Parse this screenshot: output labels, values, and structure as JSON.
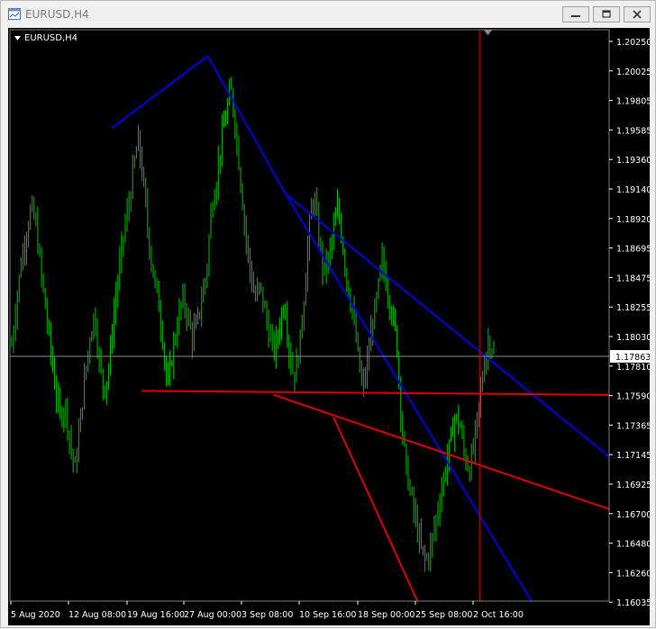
{
  "window": {
    "title": "EURUSD,H4",
    "minimize_icon": "minimize-icon",
    "restore_icon": "restore-icon",
    "close_icon": "close-icon"
  },
  "chart": {
    "symbol_label": "EURUSD,H4",
    "current_price": "1.17863",
    "colors": {
      "background": "#000000",
      "candles": "#00c000",
      "trendline_blue": "#0000dd",
      "trendline_red": "#dd0000",
      "crosshair": "#c00000",
      "axis_text": "#ffffff",
      "price_label_bg": "#ffffff"
    }
  },
  "chart_data": {
    "type": "candlestick",
    "symbol": "EURUSD",
    "timeframe": "H4",
    "y_ticks": [
      "1.20250",
      "1.20025",
      "1.19805",
      "1.19585",
      "1.19360",
      "1.19140",
      "1.18920",
      "1.18695",
      "1.18475",
      "1.18255",
      "1.18030",
      "1.17810",
      "1.17590",
      "1.17365",
      "1.17145",
      "1.16925",
      "1.16700",
      "1.16480",
      "1.16260",
      "1.16035"
    ],
    "x_ticks": [
      "5 Aug 2020",
      "12 Aug 08:00",
      "19 Aug 16:00",
      "27 Aug 00:00",
      "3 Sep 08:00",
      "10 Sep 16:00",
      "18 Sep 00:00",
      "25 Sep 08:00",
      "2 Oct 16:00"
    ],
    "ylim": [
      1.16,
      1.2035
    ],
    "current_price": 1.17863,
    "closes": [
      1.1795,
      1.183,
      1.186,
      1.188,
      1.19,
      1.1885,
      1.185,
      1.182,
      1.179,
      1.176,
      1.174,
      1.175,
      1.172,
      1.17,
      1.1735,
      1.177,
      1.18,
      1.182,
      1.178,
      1.176,
      1.178,
      1.182,
      1.185,
      1.188,
      1.19,
      1.193,
      1.195,
      1.192,
      1.188,
      1.185,
      1.183,
      1.18,
      1.176,
      1.179,
      1.181,
      1.183,
      1.182,
      1.18,
      1.181,
      1.183,
      1.185,
      1.19,
      1.192,
      1.195,
      1.197,
      1.199,
      1.196,
      1.192,
      1.188,
      1.185,
      1.183,
      1.184,
      1.182,
      1.18,
      1.179,
      1.181,
      1.183,
      1.179,
      1.177,
      1.179,
      1.183,
      1.188,
      1.191,
      1.188,
      1.185,
      1.186,
      1.188,
      1.19,
      1.187,
      1.184,
      1.182,
      1.179,
      1.176,
      1.178,
      1.181,
      1.183,
      1.186,
      1.184,
      1.182,
      1.18,
      1.174,
      1.17,
      1.168,
      1.166,
      1.164,
      1.163,
      1.164,
      1.166,
      1.168,
      1.17,
      1.172,
      1.174,
      1.1735,
      1.171,
      1.17,
      1.172,
      1.175,
      1.178,
      1.18,
      1.179
    ],
    "trendlines": [
      {
        "color": "blue",
        "points": [
          [
            1.196,
            0.17
          ],
          [
            1.2015,
            0.33
          ]
        ]
      },
      {
        "color": "blue",
        "points": [
          [
            1.2015,
            0.33
          ],
          [
            1.191,
            0.46
          ]
        ]
      },
      {
        "color": "blue",
        "points": [
          [
            1.191,
            0.46
          ],
          [
            1.171,
            1.0
          ]
        ]
      },
      {
        "color": "blue",
        "points": [
          [
            1.191,
            0.46
          ],
          [
            1.16,
            0.87
          ]
        ]
      },
      {
        "color": "red",
        "points": [
          [
            1.176,
            0.22
          ],
          [
            1.1757,
            1.0
          ]
        ]
      },
      {
        "color": "red",
        "points": [
          [
            1.1757,
            0.44
          ],
          [
            1.167,
            1.0
          ]
        ]
      },
      {
        "color": "red",
        "points": [
          [
            1.174,
            0.54
          ],
          [
            1.16,
            0.68
          ]
        ]
      }
    ]
  }
}
